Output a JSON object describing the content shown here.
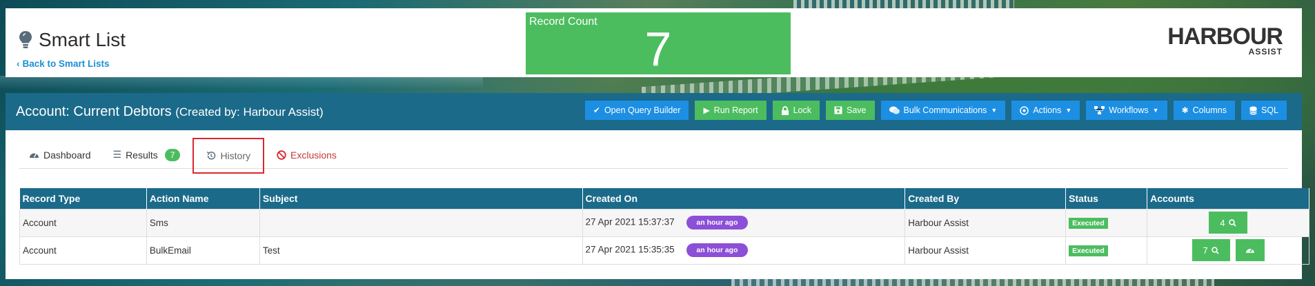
{
  "header": {
    "title": "Smart List",
    "back_link": "Back to Smart Lists",
    "record_count_label": "Record Count",
    "record_count_value": "7",
    "logo_main": "HARBOUR",
    "logo_sub": "ASSIST"
  },
  "panel": {
    "title": "Account: Current Debtors",
    "created_by": "(Created by: Harbour Assist)"
  },
  "toolbar": [
    {
      "label": "Open Query Builder",
      "icon": "check-icon",
      "color": "blue"
    },
    {
      "label": "Run Report",
      "icon": "play-icon",
      "color": "green"
    },
    {
      "label": "Lock",
      "icon": "lock-icon",
      "color": "green"
    },
    {
      "label": "Save",
      "icon": "save-icon",
      "color": "green"
    },
    {
      "label": "Bulk Communications",
      "icon": "comments-icon",
      "color": "blue",
      "dropdown": true
    },
    {
      "label": "Actions",
      "icon": "actions-icon",
      "color": "blue",
      "dropdown": true
    },
    {
      "label": "Workflows",
      "icon": "sitemap-icon",
      "color": "blue",
      "dropdown": true
    },
    {
      "label": "Columns",
      "icon": "gear-icon",
      "color": "blue"
    },
    {
      "label": "SQL",
      "icon": "database-icon",
      "color": "blue"
    }
  ],
  "tabs": {
    "dashboard": "Dashboard",
    "results": "Results",
    "results_count": "7",
    "history": "History",
    "exclusions": "Exclusions"
  },
  "table": {
    "columns": [
      "Record Type",
      "Action Name",
      "Subject",
      "Created On",
      "Created By",
      "Status",
      "Accounts"
    ],
    "rows": [
      {
        "record_type": "Account",
        "action_name": "Sms",
        "subject": "",
        "created_on": "27 Apr 2021 15:37:37",
        "relative": "an hour ago",
        "created_by": "Harbour Assist",
        "status": "Executed",
        "accounts": "4"
      },
      {
        "record_type": "Account",
        "action_name": "BulkEmail",
        "subject": "Test",
        "created_on": "27 Apr 2021 15:35:35",
        "relative": "an hour ago",
        "created_by": "Harbour Assist",
        "status": "Executed",
        "accounts": "7"
      }
    ]
  },
  "colors": {
    "accent": "#1b6a8a",
    "green": "#4cbd5f",
    "blue": "#1c8fe3",
    "purple": "#8c4fd7",
    "link": "#1a8fd6",
    "highlight": "#d9272e"
  }
}
